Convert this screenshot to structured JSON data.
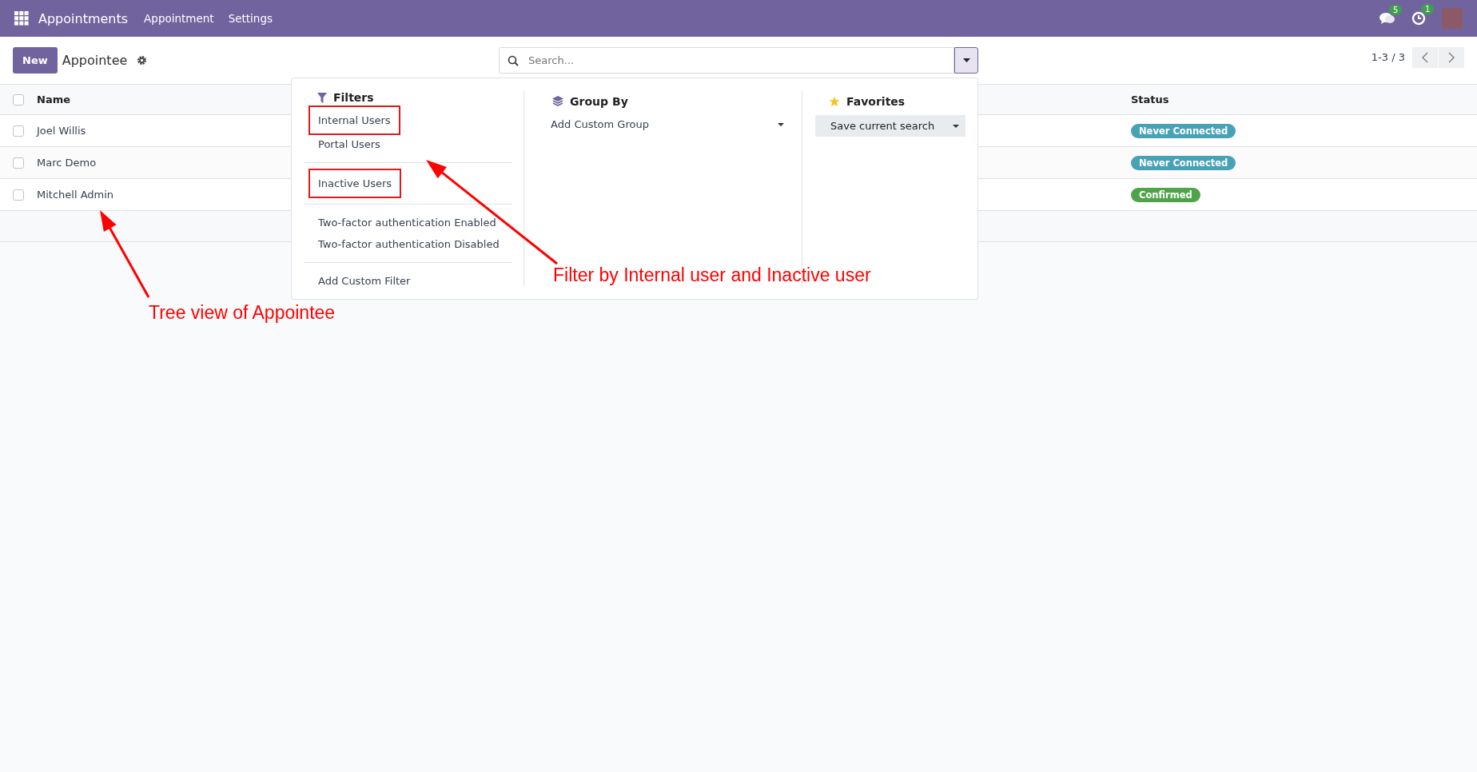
{
  "navbar": {
    "app_name": "Appointments",
    "menu": [
      "Appointment",
      "Settings"
    ],
    "messages_count": "5",
    "activities_count": "1"
  },
  "control_panel": {
    "new_button": "New",
    "breadcrumb": "Appointee",
    "search": {
      "placeholder": "Search..."
    },
    "pager": "1-3 / 3"
  },
  "table": {
    "columns": [
      "Name",
      "Status"
    ],
    "header_checked": false,
    "rows": [
      {
        "name": "Joel Willis",
        "status": "Never Connected",
        "color": "#48a2b7",
        "checked": false
      },
      {
        "name": "Marc Demo",
        "status": "Never Connected",
        "color": "#48a2b7",
        "checked": false
      },
      {
        "name": "Mitchell Admin",
        "status": "Confirmed",
        "color": "#4fa44a",
        "checked": false
      }
    ]
  },
  "search_panel": {
    "filters": {
      "title": "Filters",
      "groups": [
        [
          {
            "label": "Internal Users",
            "highlighted": true
          },
          {
            "label": "Portal Users",
            "highlighted": false
          }
        ],
        [
          {
            "label": "Inactive Users",
            "highlighted": true
          }
        ],
        [
          {
            "label": "Two-factor authentication Enabled",
            "highlighted": false
          },
          {
            "label": "Two-factor authentication Disabled",
            "highlighted": false
          }
        ],
        [
          {
            "label": "Add Custom Filter",
            "highlighted": false
          }
        ]
      ]
    },
    "group_by": {
      "title": "Group By",
      "select": "Add Custom Group"
    },
    "favorites": {
      "title": "Favorites",
      "button": "Save current search"
    }
  },
  "annotations": [
    {
      "text": "Tree view of Appointee",
      "kind": "left"
    },
    {
      "text": "Filter by Internal user and Inactive user",
      "kind": "right"
    }
  ]
}
